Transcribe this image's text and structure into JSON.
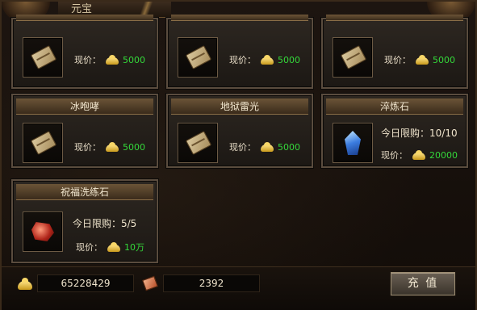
{
  "window": {
    "title": "元宝"
  },
  "items": [
    {
      "name": "",
      "type": "book",
      "price_label": "现价：",
      "price": "5000"
    },
    {
      "name": "",
      "type": "book",
      "price_label": "现价：",
      "price": "5000"
    },
    {
      "name": "",
      "type": "book",
      "price_label": "现价：",
      "price": "5000"
    },
    {
      "name": "冰咆哮",
      "type": "book",
      "price_label": "现价：",
      "price": "5000"
    },
    {
      "name": "地狱雷光",
      "type": "book",
      "price_label": "现价：",
      "price": "5000"
    },
    {
      "name": "淬炼石",
      "type": "crystal",
      "limit": "今日限购：10/10",
      "price_label": "现价：",
      "price": "20000"
    },
    {
      "name": "祝福洗练石",
      "type": "ore",
      "limit": "今日限购：5/5",
      "price_label": "现价：",
      "price": "10万"
    }
  ],
  "footer": {
    "gold_value": "65228429",
    "gem_value": "2392",
    "recharge_label": "充 值"
  },
  "colors": {
    "price_green": "#34d83a",
    "header_brown": "#6b5437",
    "frame_border": "#5a4c3e"
  }
}
